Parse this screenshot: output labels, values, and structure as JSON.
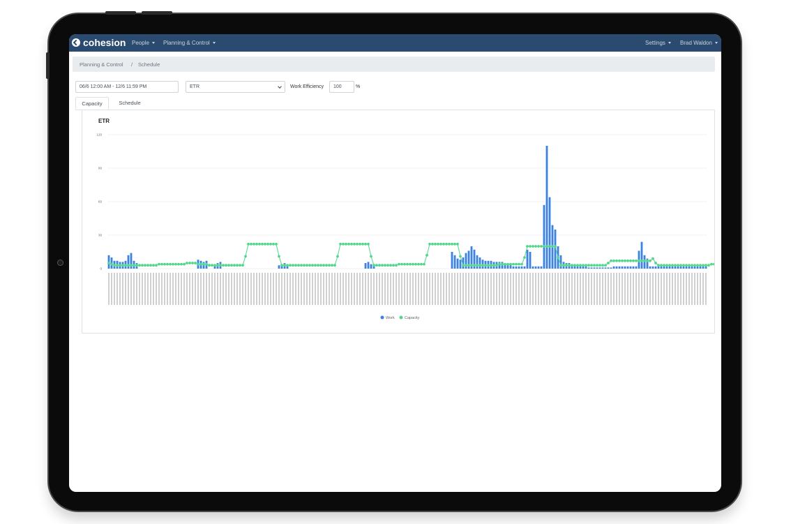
{
  "app": {
    "brand": "cohesion",
    "nav": {
      "people": "People",
      "planning": "Planning & Control",
      "settings": "Settings",
      "user": "Brad Waldon"
    },
    "breadcrumb": {
      "parent": "Planning & Control",
      "separator": "/",
      "current": "Schedule"
    },
    "filters": {
      "date_range": "06/6 12:00 AM - 12/6 11:59 PM",
      "resource": "ETR",
      "efficiency_label": "Work Efficiency",
      "efficiency_value": "100",
      "efficiency_unit": "%"
    },
    "tabs": [
      {
        "label": "Capacity",
        "active": true
      },
      {
        "label": "Schedule",
        "active": false
      }
    ]
  },
  "colors": {
    "navbar": "#2b4a6f",
    "work": "#3b82e6",
    "capacity": "#52d68a"
  },
  "chart_data": {
    "type": "bar",
    "title": "ETR",
    "yticks": [
      0,
      30,
      60,
      90,
      120
    ],
    "ylim": [
      0,
      120
    ],
    "grid": true,
    "legend_position": "bottom",
    "series": [
      {
        "name": "Work",
        "type": "bar",
        "values": [
          12,
          10,
          7,
          7,
          6,
          6,
          7,
          12,
          14,
          7,
          5,
          0,
          0,
          0,
          0,
          0,
          0,
          0,
          0,
          0,
          0,
          0,
          0,
          0,
          0,
          0,
          0,
          0,
          0,
          0,
          0,
          0,
          8,
          7,
          6,
          7,
          0,
          0,
          3,
          5,
          6,
          0,
          0,
          0,
          0,
          0,
          0,
          0,
          0,
          0,
          0,
          0,
          0,
          0,
          0,
          0,
          0,
          0,
          0,
          0,
          0,
          3,
          4,
          5,
          4,
          0,
          0,
          0,
          0,
          0,
          0,
          0,
          0,
          0,
          0,
          0,
          0,
          0,
          0,
          0,
          0,
          0,
          0,
          0,
          0,
          0,
          0,
          0,
          0,
          0,
          0,
          0,
          5,
          6,
          4,
          4,
          0,
          0,
          0,
          0,
          0,
          0,
          0,
          0,
          0,
          0,
          0,
          0,
          0,
          0,
          0,
          0,
          0,
          0,
          0,
          0,
          0,
          0,
          0,
          0,
          0,
          0,
          0,
          15,
          12,
          9,
          8,
          10,
          14,
          16,
          20,
          17,
          12,
          10,
          8,
          7,
          7,
          7,
          6,
          6,
          6,
          6,
          5,
          4,
          3,
          2,
          2,
          2,
          2,
          2,
          17,
          15,
          2,
          2,
          2,
          2,
          57,
          110,
          64,
          39,
          35,
          20,
          12,
          6,
          5,
          5,
          3,
          3,
          3,
          2,
          2,
          2,
          1,
          1,
          1,
          1,
          1,
          1,
          1,
          1,
          1,
          2,
          2,
          2,
          2,
          2,
          2,
          2,
          2,
          2,
          16,
          24,
          12,
          9,
          2,
          2,
          2,
          2,
          2,
          2,
          2,
          2,
          2,
          2,
          2,
          2,
          2,
          2,
          2,
          2,
          2,
          2,
          2,
          2,
          2
        ]
      },
      {
        "name": "Capacity",
        "type": "line",
        "values": [
          5,
          4,
          3,
          3,
          3,
          3,
          3,
          3,
          3,
          3,
          3,
          3,
          3,
          3,
          3,
          3,
          3,
          3,
          4,
          4,
          4,
          4,
          4,
          4,
          4,
          4,
          4,
          4,
          5,
          5,
          5,
          5,
          4,
          4,
          4,
          4,
          3,
          3,
          3,
          3,
          3,
          3,
          3,
          3,
          3,
          3,
          3,
          3,
          3,
          11,
          22,
          22,
          22,
          22,
          22,
          22,
          22,
          22,
          22,
          22,
          22,
          11,
          3,
          3,
          3,
          3,
          3,
          3,
          3,
          3,
          3,
          3,
          3,
          3,
          3,
          3,
          3,
          3,
          3,
          3,
          3,
          3,
          11,
          22,
          22,
          22,
          22,
          22,
          22,
          22,
          22,
          22,
          22,
          22,
          11,
          3,
          3,
          3,
          3,
          3,
          3,
          3,
          3,
          3,
          4,
          4,
          4,
          4,
          4,
          4,
          4,
          4,
          4,
          4,
          12,
          22,
          22,
          22,
          22,
          22,
          22,
          22,
          22,
          22,
          22,
          22,
          11,
          3,
          3,
          3,
          3,
          3,
          3,
          3,
          3,
          3,
          3,
          3,
          3,
          3,
          4,
          4,
          4,
          4,
          4,
          4,
          4,
          4,
          4,
          10,
          20,
          20,
          20,
          20,
          20,
          20,
          20,
          20,
          20,
          20,
          20,
          10,
          3,
          3,
          3,
          3,
          3,
          3,
          3,
          3,
          3,
          3,
          3,
          3,
          3,
          3,
          3,
          3,
          3,
          5,
          7,
          7,
          7,
          7,
          7,
          7,
          7,
          7,
          7,
          7,
          7,
          7,
          7,
          7,
          7,
          9,
          5,
          3,
          3,
          3,
          3,
          3,
          3,
          3,
          3,
          3,
          3,
          3,
          3,
          3,
          3,
          3,
          3,
          3,
          3,
          3,
          4,
          4,
          4,
          4,
          4,
          4,
          4,
          4,
          4,
          4,
          4
        ]
      }
    ]
  }
}
